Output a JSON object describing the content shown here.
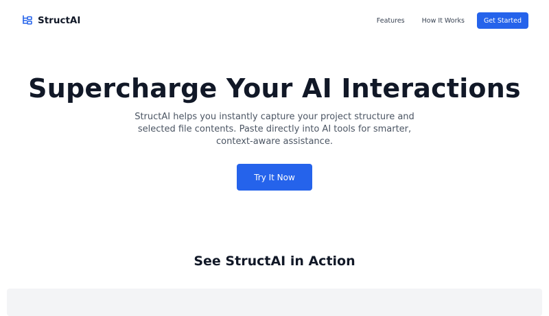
{
  "navbar": {
    "brand_name": "StructAI",
    "brand_icon": "tree-structure-icon",
    "links": [
      {
        "label": "Features"
      },
      {
        "label": "How It Works"
      }
    ],
    "cta_label": "Get Started"
  },
  "hero": {
    "title": "Supercharge Your AI Interactions",
    "subtitle": "StructAI helps you instantly capture your project structure and selected file contents. Paste directly into AI tools for smarter, context-aware assistance.",
    "button_label": "Try It Now"
  },
  "demo": {
    "title": "See StructAI in Action"
  },
  "colors": {
    "accent": "#2563eb",
    "text_dark": "#111827",
    "text_muted": "#4b5563",
    "panel_bg": "#f3f4f6"
  }
}
